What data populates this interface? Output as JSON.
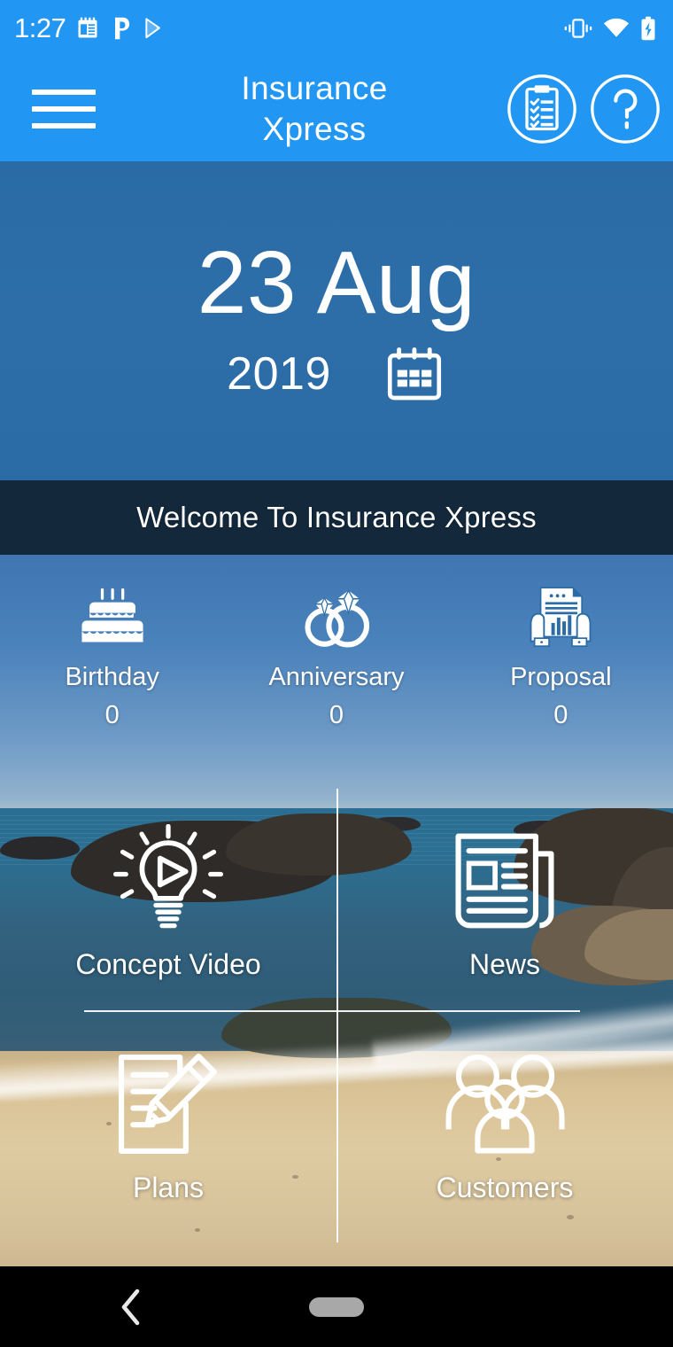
{
  "status_bar": {
    "time": "1:27",
    "left_icons": [
      "notepad-icon",
      "phonepe-icon",
      "play-store-icon"
    ],
    "right_icons": [
      "vibrate-icon",
      "wifi-icon",
      "battery-charging-icon"
    ]
  },
  "app_bar": {
    "menu": "menu-icon",
    "title_line1": "Insurance",
    "title_line2": "Xpress",
    "actions": [
      {
        "name": "checklist-icon",
        "label": "Checklist"
      },
      {
        "name": "help-icon",
        "label": "Help"
      }
    ]
  },
  "hero": {
    "day_month": "23 Aug",
    "year": "2019",
    "calendar_icon": "calendar-icon"
  },
  "welcome": {
    "text": "Welcome To Insurance Xpress"
  },
  "stats": [
    {
      "label": "Birthday",
      "count": "0",
      "icon": "birthday-cake-icon"
    },
    {
      "label": "Anniversary",
      "count": "0",
      "icon": "wedding-rings-icon"
    },
    {
      "label": "Proposal",
      "count": "0",
      "icon": "proposal-document-icon"
    }
  ],
  "tiles": [
    {
      "label": "Concept Video",
      "icon": "lightbulb-play-icon"
    },
    {
      "label": "News",
      "icon": "newspaper-icon"
    },
    {
      "label": "Plans",
      "icon": "document-pencil-icon"
    },
    {
      "label": "Customers",
      "icon": "people-group-icon"
    }
  ],
  "nav_bar": {
    "back": "back-chevron-icon",
    "home": "home-pill-icon"
  },
  "colors": {
    "primary_blue": "#2196f3",
    "hero_blue": "#2c6ca6",
    "welcome_band": "#1e415f",
    "nav_background": "#000000",
    "icon_white": "#ffffff"
  }
}
